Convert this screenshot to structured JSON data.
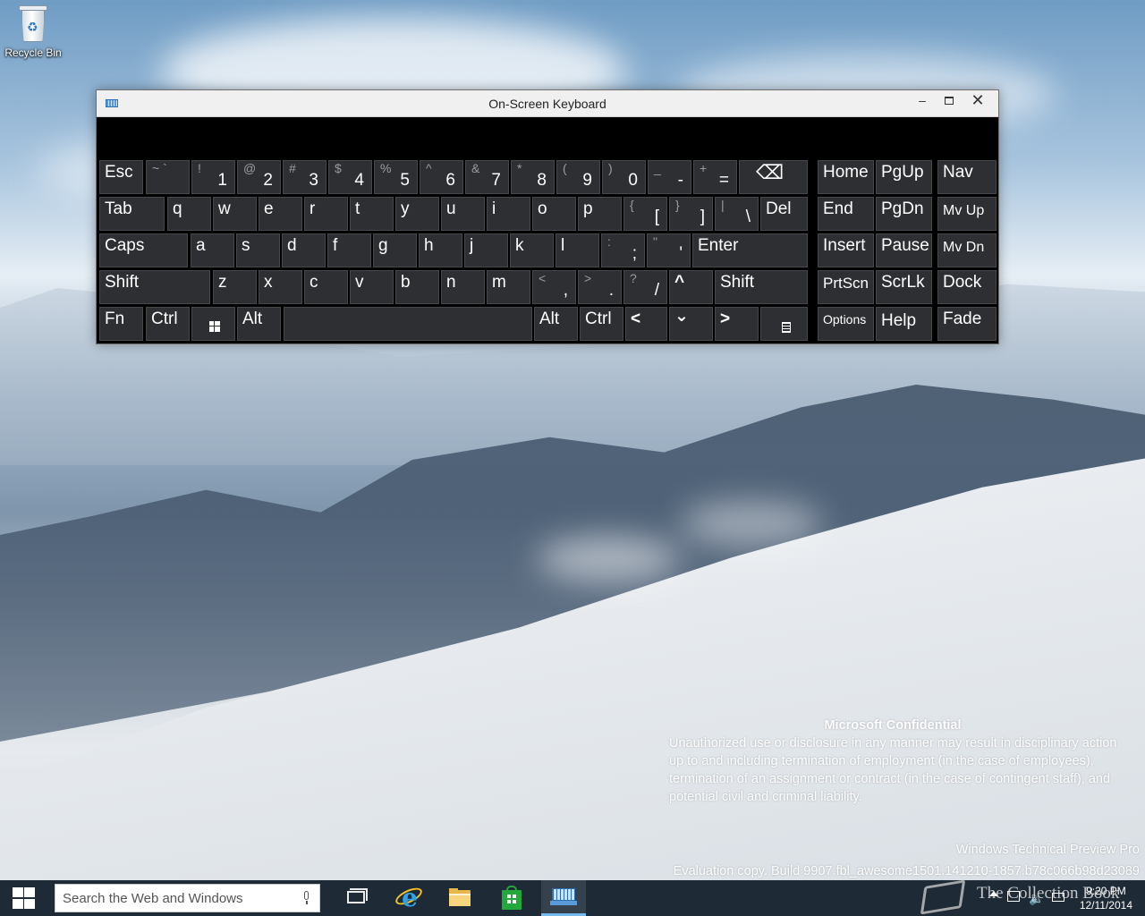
{
  "desktop": {
    "icons": [
      {
        "label": "Recycle Bin",
        "icon": "recycle-bin-icon"
      }
    ]
  },
  "osk": {
    "title": "On-Screen Keyboard",
    "controls": {
      "minimize": "–",
      "close": "✕"
    },
    "rows": {
      "row1": {
        "esc": "Esc",
        "num": [
          {
            "s": "~ `",
            "m": ""
          },
          {
            "s": "!",
            "m": "1"
          },
          {
            "s": "@",
            "m": "2"
          },
          {
            "s": "#",
            "m": "3"
          },
          {
            "s": "$",
            "m": "4"
          },
          {
            "s": "%",
            "m": "5"
          },
          {
            "s": "^",
            "m": "6"
          },
          {
            "s": "&",
            "m": "7"
          },
          {
            "s": "*",
            "m": "8"
          },
          {
            "s": "(",
            "m": "9"
          },
          {
            "s": ")",
            "m": "0"
          },
          {
            "s": "_",
            "m": "-"
          },
          {
            "s": "+",
            "m": "="
          }
        ],
        "backspace": "⌫",
        "nav": [
          "Home",
          "PgUp",
          "Nav"
        ]
      },
      "row2": {
        "tab": "Tab",
        "letters": [
          "q",
          "w",
          "e",
          "r",
          "t",
          "y",
          "u",
          "i",
          "o",
          "p"
        ],
        "brackets": [
          {
            "s": "{",
            "m": "["
          },
          {
            "s": "}",
            "m": "]"
          },
          {
            "s": "|",
            "m": "\\"
          }
        ],
        "del": "Del",
        "nav": [
          "End",
          "PgDn",
          "Mv Up"
        ]
      },
      "row3": {
        "caps": "Caps",
        "letters": [
          "a",
          "s",
          "d",
          "f",
          "g",
          "h",
          "j",
          "k",
          "l"
        ],
        "punct": [
          {
            "s": ":",
            "m": ";"
          },
          {
            "s": "\"",
            "m": "'"
          }
        ],
        "enter": "Enter",
        "nav": [
          "Insert",
          "Pause",
          "Mv Dn"
        ]
      },
      "row4": {
        "shift_l": "Shift",
        "letters": [
          "z",
          "x",
          "c",
          "v",
          "b",
          "n",
          "m"
        ],
        "punct": [
          {
            "s": "<",
            "m": ","
          },
          {
            "s": ">",
            "m": "."
          },
          {
            "s": "?",
            "m": "/"
          }
        ],
        "up": "^",
        "shift_r": "Shift",
        "nav": [
          "PrtScn",
          "ScrLk",
          "Dock"
        ]
      },
      "row5": {
        "fn": "Fn",
        "ctrl_l": "Ctrl",
        "alt_l": "Alt",
        "alt_r": "Alt",
        "ctrl_r": "Ctrl",
        "left": "<",
        "down": "⌄",
        "right": ">",
        "nav": [
          "Options",
          "Help",
          "Fade"
        ]
      }
    }
  },
  "watermark": {
    "heading": "Microsoft Confidential",
    "body": "Unauthorized use or disclosure in any manner may result in disciplinary action up to and including termination of employment (in the case of employees), termination of an assignment or contract (in the case of contingent staff), and potential civil and criminal liability.",
    "edition": "Windows Technical Preview Pro",
    "build": "Evaluation copy. Build 9907.fbl_awesome1501.141210-1857.b78c066b98d23089"
  },
  "taskbar": {
    "search_placeholder": "Search the Web and Windows",
    "apps": [
      "task-view-icon",
      "internet-explorer-icon",
      "file-explorer-icon",
      "store-icon",
      "on-screen-keyboard-icon"
    ],
    "time": "9:20 PM",
    "date": "12/11/2014",
    "collection_watermark": "The Collection Book"
  }
}
